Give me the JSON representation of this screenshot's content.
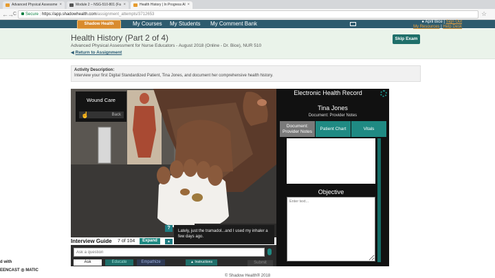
{
  "browser": {
    "tabs": [
      {
        "label": "Advanced Physical Assessme",
        "active": false
      },
      {
        "label": "Module 2 – NSG-510-801 (Fa",
        "active": false
      },
      {
        "label": "Health History | In Progress Al",
        "active": true
      }
    ],
    "secure_label": "Secure",
    "url_host": "https://app.shadowhealth.com",
    "url_path": "/assignment_attempts/3712653",
    "nav_back": "←",
    "nav_forward": "→",
    "nav_reload": "C",
    "close_glyph": "×",
    "star_glyph": "☆"
  },
  "header": {
    "logo": "Shadow Health",
    "nav": [
      "My Courses",
      "My Students",
      "My Comment Bank"
    ],
    "user_name": "April Bice",
    "user_sep": "|",
    "sign_out": "Sign Out",
    "my_resources": "My Resources",
    "help_desk": "Help Desk"
  },
  "page": {
    "title": "Health History (Part 2 of 4)",
    "subtitle": "Advanced Physical Assessment for Nurse Educators - August 2018 (Online - Dr. Bice), NUR 510",
    "return_arrow": "◀",
    "return_link": "Return to Assignment",
    "skip_button": "Skip Exam"
  },
  "activity": {
    "label": "Activity Description:",
    "text": "Interview your first Digital Standardized Patient, Tina Jones, and document her comprehensive health history."
  },
  "scene": {
    "panel_title": "Wound Care",
    "panel_back": "Back",
    "hand_glyph": "☝",
    "speech": "Lately, just the tramadol...and I used my inhaler a few days ago.",
    "help_glyph": "?",
    "up_glyph": "▲"
  },
  "guide": {
    "label": "Interview Guide",
    "count": "7 of 104",
    "expand": "Expand",
    "placeholder": "Ask a question",
    "modes": [
      "Ask",
      "Educate",
      "Empathize"
    ],
    "instructions": "▲ Instructions",
    "submit": "Submit"
  },
  "ehr": {
    "title": "Electronic Health Record",
    "patient_name": "Tina Jones",
    "document_label": "Document: Provider Notes",
    "tabs": [
      "Document: Provider Notes",
      "Patient Chart",
      "Vitals"
    ],
    "objective_title": "Objective",
    "objective_placeholder": "Enter text..."
  },
  "footer": {
    "copyright": "© Shadow Health® 2018",
    "watermark_top": "d with",
    "watermark_bottom": "EENCAST ◎ MATIC"
  },
  "colors": {
    "header_bg": "#2e5b6e",
    "accent_teal": "#1f8a83",
    "accent_orange": "#d98b2d",
    "page_header_bg": "#eaf3ea"
  }
}
